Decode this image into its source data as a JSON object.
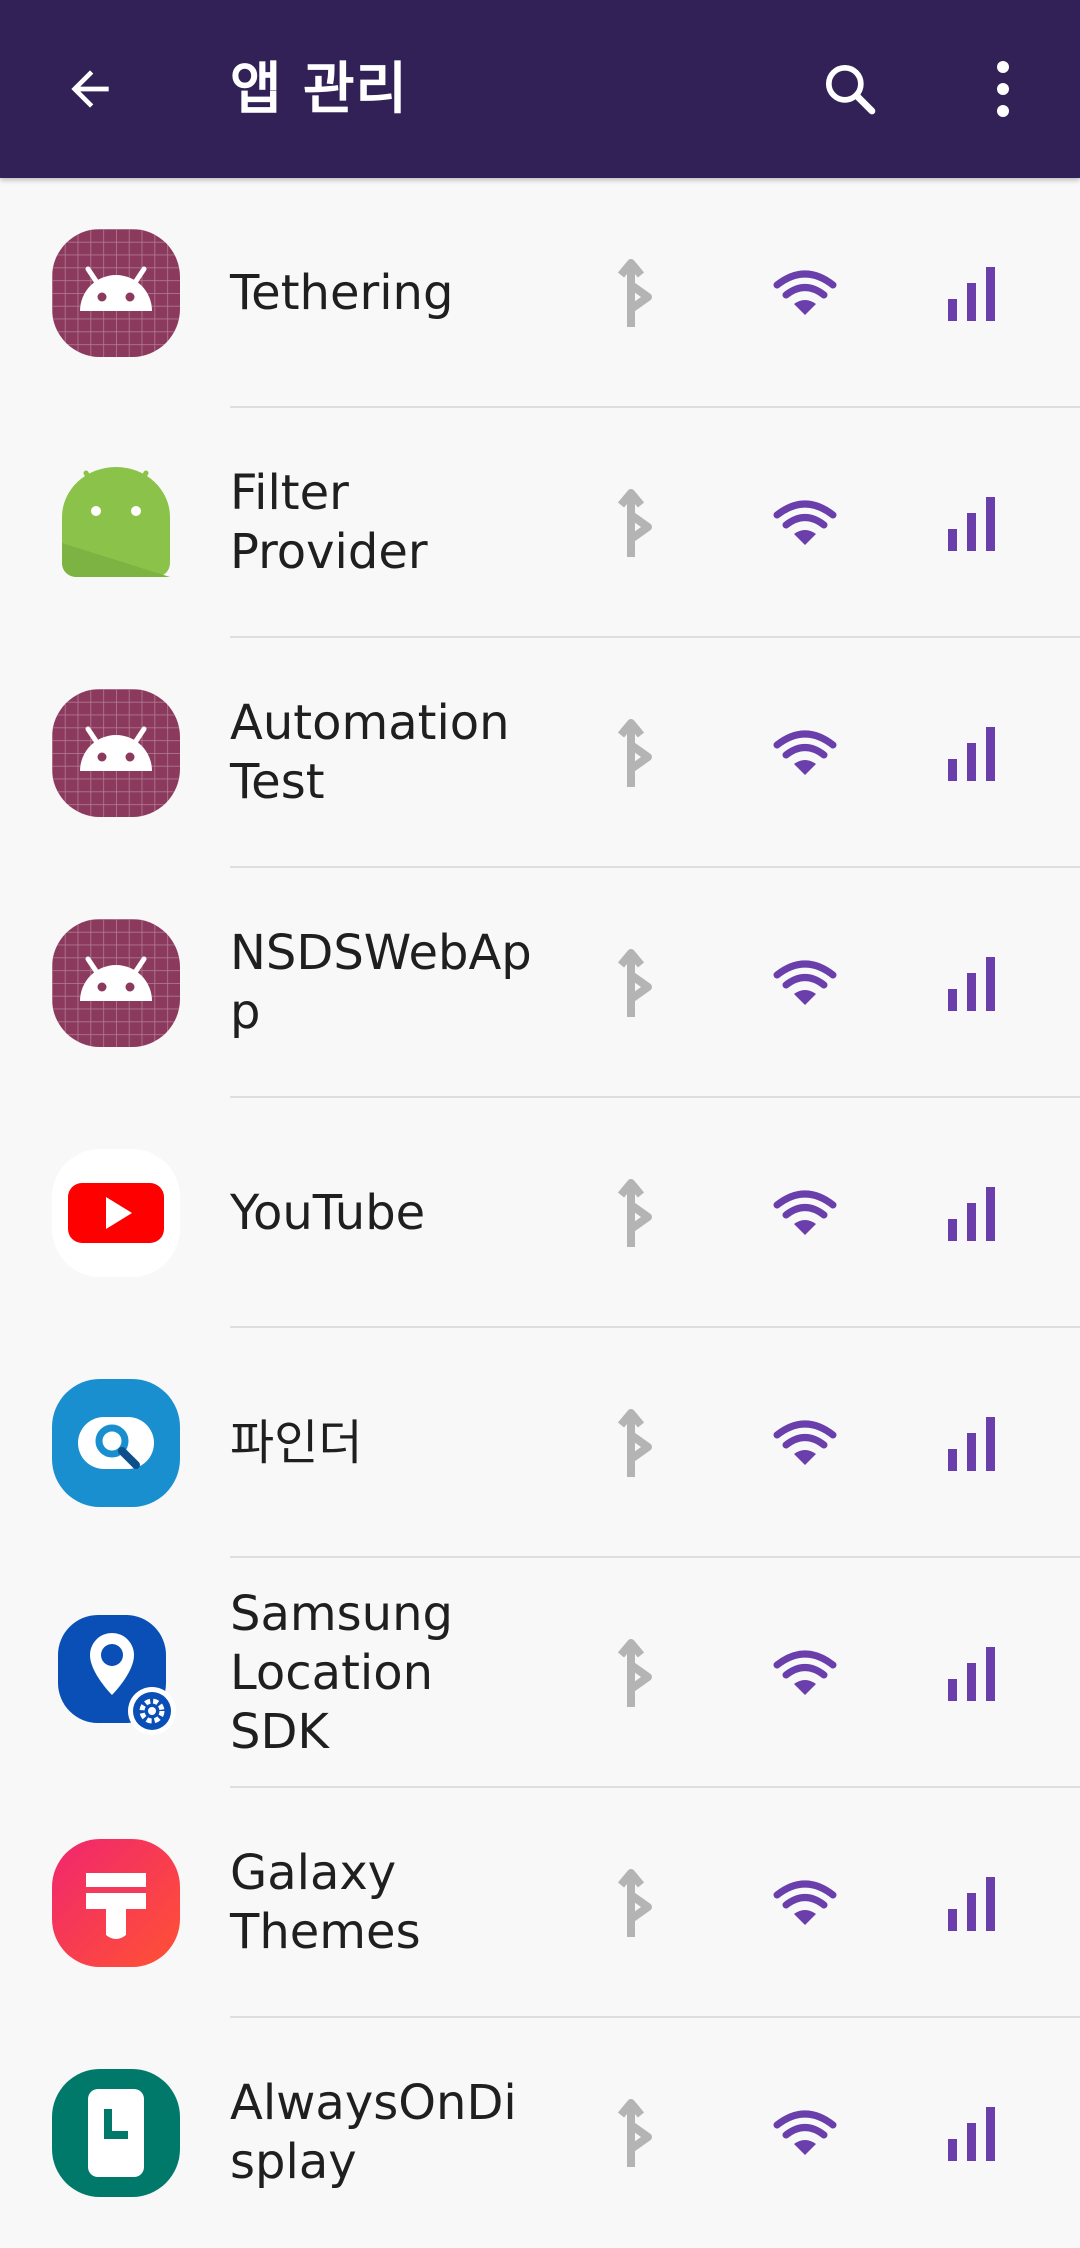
{
  "header": {
    "title": "앱 관리",
    "back_icon": "arrow-back-icon",
    "search_icon": "search-icon",
    "more_icon": "more-vertical-icon",
    "background": "#322157"
  },
  "colors": {
    "accent": "#6a3fab",
    "disabled": "#b4b4b4"
  },
  "apps": [
    {
      "label": "Tethering",
      "icon": "android-grid-icon"
    },
    {
      "label": "Filter\nProvider",
      "icon": "android-green-icon"
    },
    {
      "label": "Automation\nTest",
      "icon": "android-grid-icon"
    },
    {
      "label": "NSDSWebApp",
      "icon": "android-grid-icon"
    },
    {
      "label": "YouTube",
      "icon": "youtube-icon"
    },
    {
      "label": "파인더",
      "icon": "finder-icon"
    },
    {
      "label": "Samsung\nLocation\nSDK",
      "icon": "location-sdk-icon"
    },
    {
      "label": "Galaxy\nThemes",
      "icon": "galaxy-themes-icon"
    },
    {
      "label": "AlwaysOnDisplay",
      "icon": "always-on-display-icon"
    }
  ]
}
